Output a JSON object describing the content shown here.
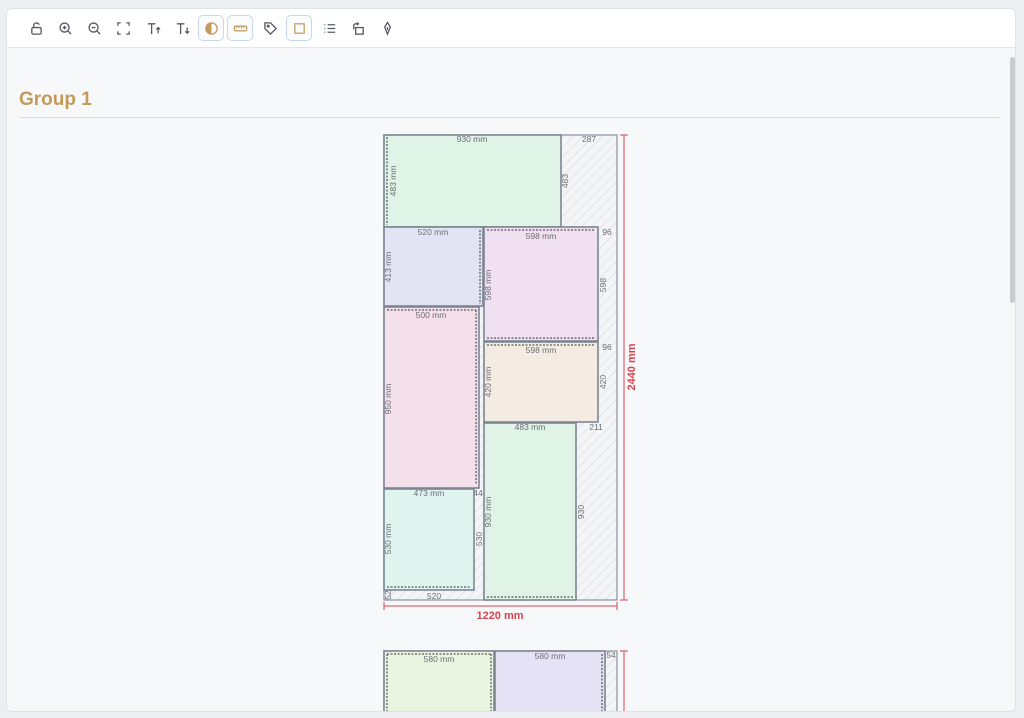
{
  "toolbar": {
    "buttons": [
      {
        "id": "unlock",
        "icon": "unlock-icon"
      },
      {
        "id": "zoom-in",
        "icon": "zoom-in-icon"
      },
      {
        "id": "zoom-out",
        "icon": "zoom-out-icon"
      },
      {
        "id": "fit",
        "icon": "fullscreen-icon"
      },
      {
        "id": "text-bigger",
        "icon": "text-increase-icon"
      },
      {
        "id": "text-smaller",
        "icon": "text-decrease-icon"
      },
      {
        "id": "contrast",
        "icon": "contrast-icon",
        "active": true
      },
      {
        "id": "ruler",
        "icon": "ruler-icon",
        "active": true
      },
      {
        "id": "tag",
        "icon": "tag-icon"
      },
      {
        "id": "square",
        "icon": "square-icon",
        "active": true
      },
      {
        "id": "list",
        "icon": "list-icon"
      },
      {
        "id": "rotate",
        "icon": "rotate-icon"
      },
      {
        "id": "pen",
        "icon": "pen-icon"
      }
    ]
  },
  "group": {
    "title": "Group 1"
  },
  "colors": {
    "green": "#dff3e6",
    "lavender": "#e2e4f3",
    "pink": "#f1e0f1",
    "rose": "#f4e0ea",
    "beige": "#f4ece2",
    "mint": "#e0f4ef",
    "lightgreen": "#e9f5e1",
    "lightpurple": "#e5e2f5",
    "dimension": "#d64550"
  },
  "board1": {
    "width_label": "1220 mm",
    "height_label": "2440 mm",
    "pieces": [
      {
        "w": 930,
        "h": 483,
        "color": "green",
        "w_label": "930 mm",
        "h_label": "483 mm"
      },
      {
        "w": 520,
        "h": 413,
        "color": "lavender",
        "w_label": "520 mm",
        "h_label": "413 mm"
      },
      {
        "w": 598,
        "h": 598,
        "color": "pink",
        "w_label": "598 mm",
        "h_label": "598 mm"
      },
      {
        "w": 500,
        "h": 950,
        "color": "rose",
        "w_label": "500 mm",
        "h_label": "950 mm"
      },
      {
        "w": 598,
        "h": 420,
        "color": "beige",
        "w_label": "598 mm",
        "h_label": "420 mm"
      },
      {
        "w": 483,
        "h": 930,
        "color": "green",
        "w_label": "483 mm",
        "h_label": "930 mm"
      },
      {
        "w": 473,
        "h": 530,
        "color": "mint",
        "w_label": "473 mm",
        "h_label": "530 mm"
      }
    ],
    "waste_labels": [
      "287",
      "483",
      "96",
      "598",
      "96",
      "420",
      "211",
      "930",
      "44",
      "530",
      "520",
      "52"
    ]
  },
  "board2": {
    "pieces": [
      {
        "color": "lightgreen",
        "w_label": "580 mm"
      },
      {
        "color": "lightpurple",
        "w_label": "580 mm"
      }
    ],
    "waste_labels": [
      "54"
    ]
  }
}
